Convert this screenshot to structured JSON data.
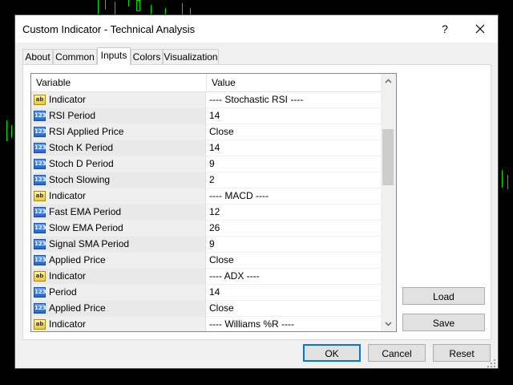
{
  "window": {
    "title": "Custom Indicator - Technical Analysis",
    "help_label": "?"
  },
  "tabs": [
    {
      "label": "About",
      "active": false
    },
    {
      "label": "Common",
      "active": false
    },
    {
      "label": "Inputs",
      "active": true
    },
    {
      "label": "Colors",
      "active": false
    },
    {
      "label": "Visualization",
      "active": false
    }
  ],
  "grid": {
    "headers": {
      "variable": "Variable",
      "value": "Value"
    },
    "rows": [
      {
        "type": "ab",
        "variable": "Indicator",
        "value": "---- Stochastic RSI ----"
      },
      {
        "type": "123",
        "variable": "RSI Period",
        "value": "14"
      },
      {
        "type": "123",
        "variable": "RSI Applied Price",
        "value": "Close"
      },
      {
        "type": "123",
        "variable": "Stoch K Period",
        "value": "14"
      },
      {
        "type": "123",
        "variable": "Stoch D Period",
        "value": "9"
      },
      {
        "type": "123",
        "variable": "Stoch Slowing",
        "value": "2"
      },
      {
        "type": "ab",
        "variable": "Indicator",
        "value": "---- MACD ----"
      },
      {
        "type": "123",
        "variable": "Fast EMA Period",
        "value": "12"
      },
      {
        "type": "123",
        "variable": "Slow EMA Period",
        "value": "26"
      },
      {
        "type": "123",
        "variable": "Signal SMA Period",
        "value": "9"
      },
      {
        "type": "123",
        "variable": "Applied Price",
        "value": "Close"
      },
      {
        "type": "ab",
        "variable": "Indicator",
        "value": "---- ADX ----"
      },
      {
        "type": "123",
        "variable": "Period",
        "value": "14"
      },
      {
        "type": "123",
        "variable": "Applied Price",
        "value": "Close"
      },
      {
        "type": "ab",
        "variable": "Indicator",
        "value": "---- Williams %R ----"
      }
    ]
  },
  "side_buttons": {
    "load": "Load",
    "save": "Save"
  },
  "footer": {
    "ok": "OK",
    "cancel": "Cancel",
    "reset": "Reset"
  },
  "icons": {
    "string_type": "ab",
    "number_type": "123",
    "close": "close-icon",
    "scroll_up": "chevron-up-icon",
    "scroll_down": "chevron-down-icon"
  },
  "colors": {
    "chart_background": "#000000",
    "candle": "#00e000",
    "default_button_border": "#0078d7"
  }
}
